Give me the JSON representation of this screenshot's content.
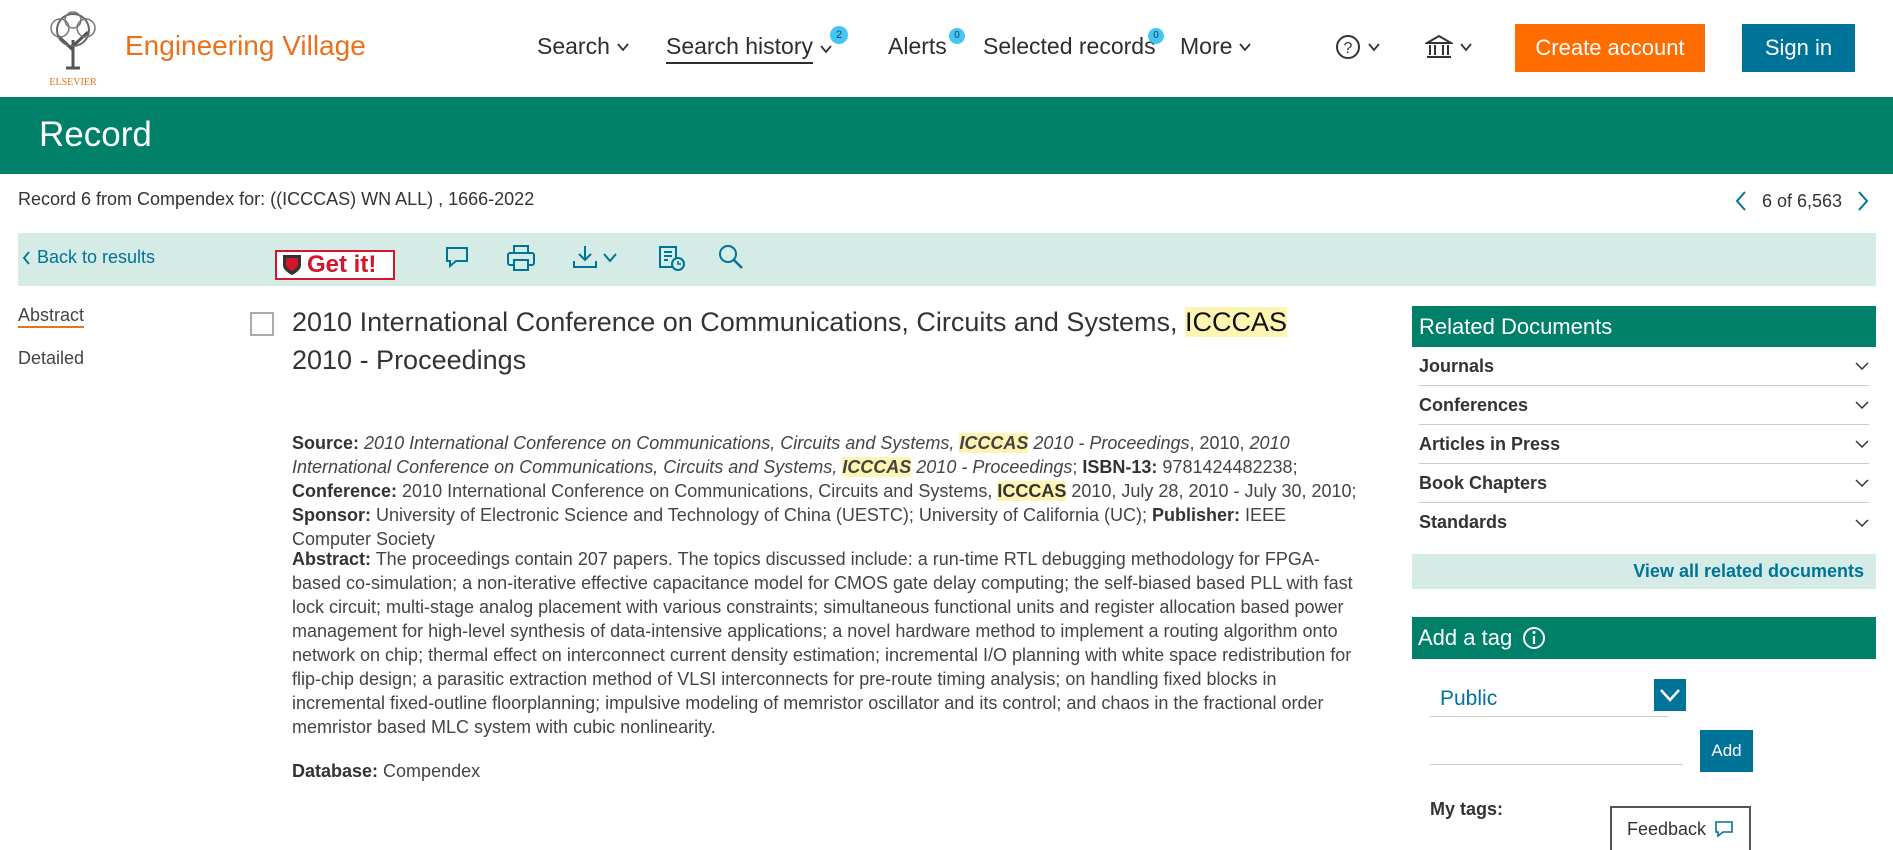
{
  "brand": {
    "publisher": "ELSEVIER",
    "name": "Engineering Village"
  },
  "nav": {
    "search": "Search",
    "history": "Search history",
    "history_count": "2",
    "alerts": "Alerts",
    "alerts_count": "0",
    "selected": "Selected records",
    "selected_count": "0",
    "more": "More"
  },
  "header": {
    "create": "Create account",
    "signin": "Sign in"
  },
  "page_title": "Record",
  "record_line": "Record 6 from Compendex for: ((ICCCAS) WN ALL) , 1666-2022",
  "pager": "6 of 6,563",
  "toolbar": {
    "back": "Back to results",
    "getit": "Get it!"
  },
  "side": {
    "abstract": "Abstract",
    "detailed": "Detailed"
  },
  "record": {
    "title_pre": "2010 International Conference on Communications, Circuits and Systems, ",
    "title_hl": "ICCCAS",
    "title_post": " 2010 - Proceedings",
    "source_label": "Source:",
    "src1": "2010 International Conference on Communications, Circuits and Systems, ",
    "hl": "ICCCAS",
    "src2": " 2010 - Proceedings",
    "src3": ", 2010, ",
    "src4": "2010 International Conference on Communications, Circuits and Systems, ",
    "src5": " 2010 - Proceedings",
    "src6": "; ",
    "isbn_label": "ISBN-13:",
    "isbn": " 9781424482238; ",
    "conf_label": "Conference:",
    "conf1": " 2010 International Conference on Communications, Circuits and Systems, ",
    "conf2": " 2010, July 28, 2010 - July 30, 2010; ",
    "sponsor_label": "Sponsor:",
    "sponsor": " University of Electronic Science and Technology of China (UESTC); University of California (UC); ",
    "publisher_label": "Publisher:",
    "publisher": " IEEE Computer Society",
    "abstract_label": "Abstract:",
    "abstract": " The proceedings contain 207 papers. The topics discussed include: a run-time RTL debugging methodology for FPGA-based co-simulation; a non-iterative effective capacitance model for CMOS gate delay computing; the self-biased based PLL with fast lock circuit; multi-stage analog placement with various constraints; simultaneous functional units and register allocation based power management for high-level synthesis of data-intensive applications; a novel hardware method to implement a routing algorithm onto network on chip; thermal effect on interconnect current density estimation; incremental I/O planning with white space redistribution for flip-chip design; a parasitic extraction method of VLSI interconnects for pre-route timing analysis; on handling fixed blocks in incremental fixed-outline floorplanning; impulsive modeling of memristor oscillator and its control; and chaos in the fractional order memristor based MLC system with cubic nonlinearity.",
    "db_label": "Database:",
    "db": " Compendex"
  },
  "related": {
    "title": "Related Documents",
    "items": [
      "Journals",
      "Conferences",
      "Articles in Press",
      "Book Chapters",
      "Standards"
    ],
    "view_all": "View all related documents"
  },
  "tag": {
    "title": "Add a tag",
    "visibility": "Public",
    "add": "Add",
    "mytags": "My tags:"
  },
  "feedback": "Feedback"
}
